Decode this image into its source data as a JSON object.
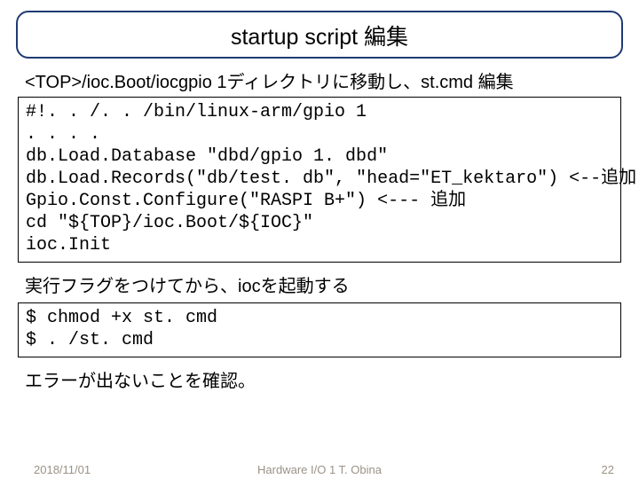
{
  "title": "startup script 編集",
  "instr1": "<TOP>/ioc.Boot/iocgpio 1ディレクトリに移動し、st.cmd 編集",
  "code1": "#!. . /. . /bin/linux-arm/gpio 1\n. . . .\ndb.Load.Database \"dbd/gpio 1. dbd\"\ndb.Load.Records(\"db/test. db\", \"head=\"ET_kektaro\") <--追加\nGpio.Const.Configure(\"RASPI B+\") <--- 追加\ncd \"${TOP}/ioc.Boot/${IOC}\"\nioc.Init",
  "note1": "実行フラグをつけてから、iocを起動する",
  "code2": "$ chmod +x st. cmd\n$ . /st. cmd",
  "note2": "エラーが出ないことを確認。",
  "footer": {
    "date": "2018/11/01",
    "center": "Hardware I/O 1 T. Obina",
    "pagenum": "22"
  }
}
